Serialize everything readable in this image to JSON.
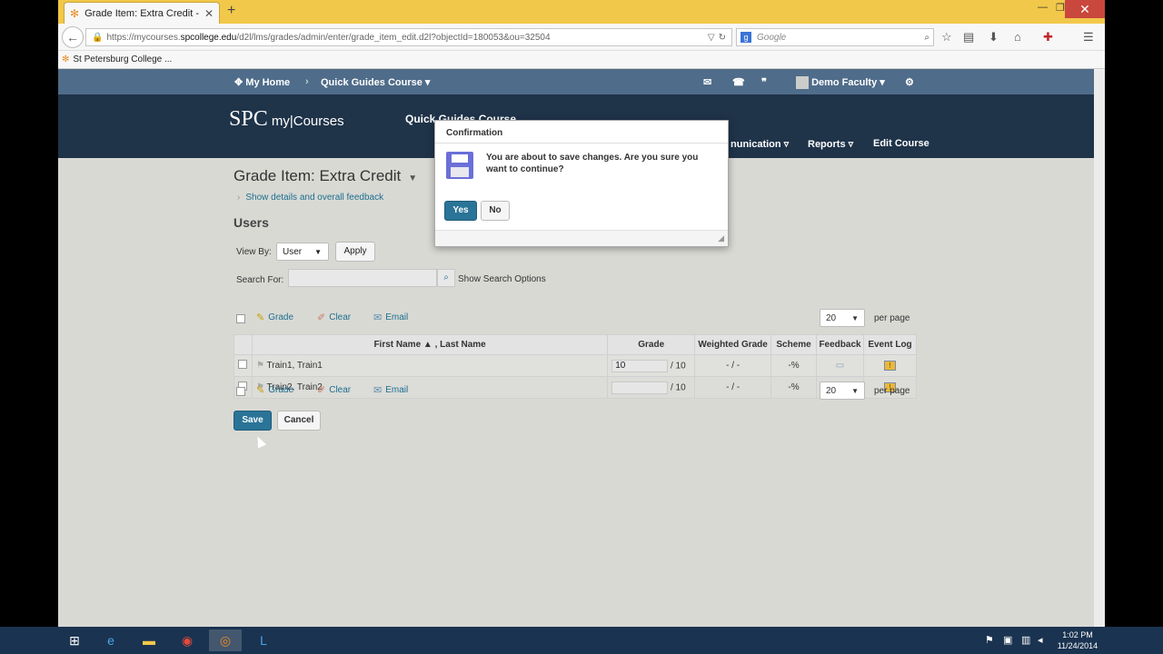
{
  "browser": {
    "tab_title": "Grade Item: Extra Credit - ...",
    "url_prefix": "https://mycourses.",
    "url_domain": "spcollege.edu",
    "url_path": "/d2l/lms/grades/admin/enter/grade_item_edit.d2l?objectId=180053&ou=32504",
    "search_placeholder": "Google",
    "bookmark": "St Petersburg College ..."
  },
  "topnav": {
    "home": "My Home",
    "course": "Quick Guides Course",
    "user": "Demo Faculty"
  },
  "header": {
    "logo_main": "SPC",
    "logo_sub": " my|Courses",
    "course_title": "Quick Guides Course",
    "nav": [
      "nunication",
      "Reports",
      "Edit Course"
    ]
  },
  "page": {
    "title": "Grade Item: Extra Credit",
    "details_link": "Show details and overall feedback",
    "users_heading": "Users",
    "view_by_label": "View By:",
    "view_by_value": "User",
    "apply": "Apply",
    "search_for_label": "Search For:",
    "show_search_options": "Show Search Options",
    "actions": {
      "grade": "Grade",
      "clear": "Clear",
      "email": "Email"
    },
    "per_page_value": "20",
    "per_page_label": "per page",
    "columns": [
      "First Name ▲ , Last Name",
      "Grade",
      "Weighted Grade",
      "Scheme",
      "Feedback",
      "Event Log"
    ],
    "rows": [
      {
        "name": "Train1, Train1",
        "grade": "10",
        "out_of": "/ 10",
        "weighted": "- / -",
        "scheme": "-%"
      },
      {
        "name": "Train2, Train2",
        "grade": "",
        "out_of": "/ 10",
        "weighted": "- / -",
        "scheme": "-%"
      }
    ],
    "save": "Save",
    "cancel": "Cancel"
  },
  "dialog": {
    "title": "Confirmation",
    "message": "You are about to save changes. Are you sure you want to continue?",
    "yes": "Yes",
    "no": "No"
  },
  "taskbar": {
    "time": "1:02 PM",
    "date": "11/24/2014"
  },
  "colors": {
    "titlebar": "#f2c84a",
    "topnav": "#4f6c8a",
    "header": "#1f3349",
    "primary_button": "#2a7497",
    "link": "#1e6f8f",
    "taskbar": "#1a3350"
  }
}
